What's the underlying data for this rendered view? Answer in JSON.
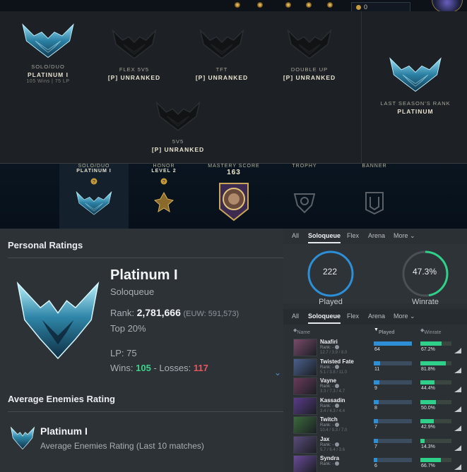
{
  "topbar": {
    "currency_value": "0",
    "colors": {
      "gold": "#c89b3c",
      "panel": "#1d2024"
    }
  },
  "rank_panel": {
    "queues": [
      {
        "queue": "SOLO/DUO",
        "rank": "PLATINUM I",
        "detail": "105 Wins | 75 LP",
        "icon": "platinum-emblem-icon"
      },
      {
        "queue": "FLEX 5V5",
        "rank": "[P] UNRANKED",
        "icon": "unranked-emblem-icon"
      },
      {
        "queue": "TFT",
        "rank": "[P] UNRANKED",
        "icon": "unranked-emblem-icon"
      },
      {
        "queue": "DOUBLE UP",
        "rank": "[P] UNRANKED",
        "icon": "unranked-emblem-icon"
      },
      {
        "queue": "5V5",
        "rank": "[P] UNRANKED",
        "icon": "unranked-emblem-icon"
      }
    ],
    "last_season": {
      "label": "LAST SEASON'S RANK",
      "rank": "PLATINUM"
    }
  },
  "profile_strip": {
    "solo": {
      "label": "SOLO/DUO",
      "value": "PLATINUM I"
    },
    "honor": {
      "label": "HONOR",
      "value": "LEVEL 2"
    },
    "mastery": {
      "label": "MASTERY SCORE",
      "value": "163"
    },
    "trophy": {
      "label": "TROPHY"
    },
    "banner": {
      "label": "BANNER"
    }
  },
  "ratings": {
    "heading": "Personal Ratings",
    "rank_title": "Platinum I",
    "queue": "Soloqueue",
    "rank_label": "Rank:",
    "rank_value": "2,781,666",
    "rank_region": "(EUW: 591,573)",
    "top": "Top 20%",
    "lp": "LP: 75",
    "wins_label": "Wins:",
    "wins": "105",
    "losses_label": "- Losses:",
    "losses": "117",
    "avg_heading": "Average Enemies Rating",
    "avg_rank": "Platinum I",
    "avg_desc": "Average Enemies Rating (Last 10 matches)"
  },
  "stats": {
    "tabs": [
      "All",
      "Soloqueue",
      "Flex",
      "Arena",
      "More ⌄"
    ],
    "active_tab": "Soloqueue",
    "played": {
      "value": "222",
      "label": "Played",
      "color": "#2d8fd5"
    },
    "winrate": {
      "value": "47.3%",
      "label": "Winrate",
      "fraction": 0.473,
      "color": "#2fd08a"
    },
    "columns": {
      "name": "Name",
      "played": "Played",
      "winrate": "Winrate"
    },
    "champions": [
      {
        "name": "Naafiri",
        "rank": "Rank: -",
        "kda": "12.7 / 3.9 / 8.0",
        "played": "64",
        "played_frac": 1.0,
        "winrate": "67.2%",
        "win_frac": 0.672,
        "color": "#7a4a6a"
      },
      {
        "name": "Twisted Fate",
        "rank": "Rank: -",
        "kda": "5.1 / 3.8 / 11.0",
        "played": "11",
        "played_frac": 0.17,
        "winrate": "81.8%",
        "win_frac": 0.818,
        "color": "#4a5f8c"
      },
      {
        "name": "Vayne",
        "rank": "Rank: -",
        "kda": "3.3 / 7.3 / 4.7",
        "played": "9",
        "played_frac": 0.14,
        "winrate": "44.4%",
        "win_frac": 0.444,
        "color": "#6a3a5a"
      },
      {
        "name": "Kassadin",
        "rank": "Rank: -",
        "kda": "3.4 / 4.3 / 4.4",
        "played": "8",
        "played_frac": 0.13,
        "winrate": "50.0%",
        "win_frac": 0.5,
        "color": "#5a3a8a"
      },
      {
        "name": "Twitch",
        "rank": "Rank: -",
        "kda": "10.4 / 9.3 / 7.0",
        "played": "7",
        "played_frac": 0.11,
        "winrate": "42.9%",
        "win_frac": 0.429,
        "color": "#3a6a3a"
      },
      {
        "name": "Jax",
        "rank": "Rank: -",
        "kda": "5.7 / 6.4 / 3.6",
        "played": "7",
        "played_frac": 0.11,
        "winrate": "14.3%",
        "win_frac": 0.143,
        "color": "#5a4a7a"
      },
      {
        "name": "Syndra",
        "rank": "Rank: -",
        "kda": "",
        "played": "6",
        "played_frac": 0.09,
        "winrate": "66.7%",
        "win_frac": 0.667,
        "color": "#6a4a9a"
      }
    ]
  }
}
